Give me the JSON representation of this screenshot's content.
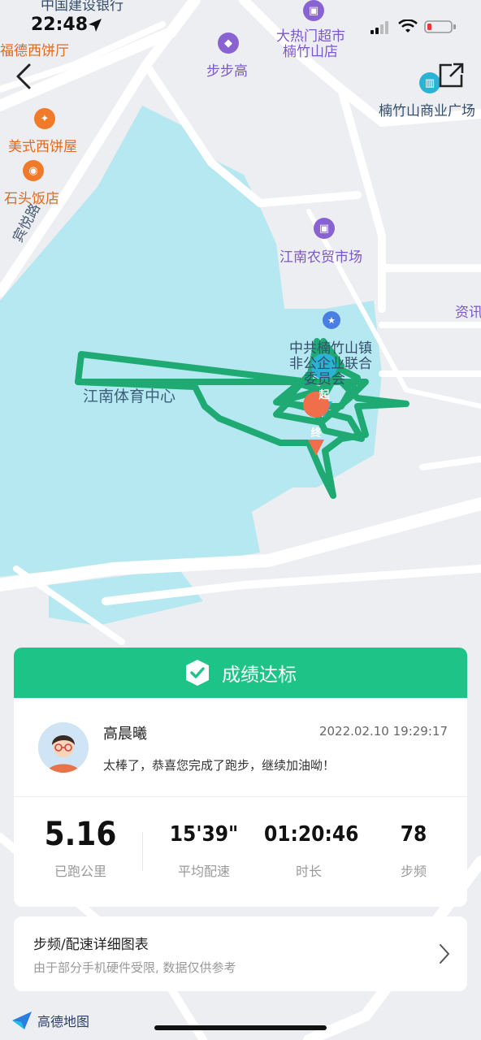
{
  "status_bar": {
    "time": "22:48"
  },
  "map": {
    "pois": {
      "bank_partial": "中国建设银行",
      "fuchsia_restaurant": "福德西饼厅",
      "bubugao": "步步高",
      "supermarket_line1": "大热门超市",
      "supermarket_line2": "楠竹山店",
      "plaza": "楠竹山商业广场",
      "western_bakery": "美式西饼屋",
      "stone_restaurant": "石头饭店",
      "road_name": "宾悦路",
      "farm_market": "江南农贸市场",
      "info_partial": "资讯",
      "party_line1": "中共楠竹山镇",
      "party_line2": "非公企业联合",
      "party_line3": "委员会",
      "sports_center": "江南体育中心"
    },
    "start_marker": "起",
    "end_marker": "终",
    "brand": "高德地图"
  },
  "achievement": {
    "label": "成绩达标"
  },
  "user": {
    "name": "高晨曦",
    "datetime": "2022.02.10 19:29:17",
    "message": "太棒了，恭喜您完成了跑步，继续加油呦！"
  },
  "stats": [
    {
      "value": "5.16",
      "label": "已跑公里"
    },
    {
      "value": "15'39\"",
      "label": "平均配速"
    },
    {
      "value": "01:20:46",
      "label": "时长"
    },
    {
      "value": "78",
      "label": "步频"
    }
  ],
  "detail": {
    "title": "步频/配速详细图表",
    "subtitle": "由于部分手机硬件受限, 数据仅供参考"
  },
  "colors": {
    "accent": "#1ec487",
    "route": "#1faa74",
    "water": "#b5e8f0"
  }
}
